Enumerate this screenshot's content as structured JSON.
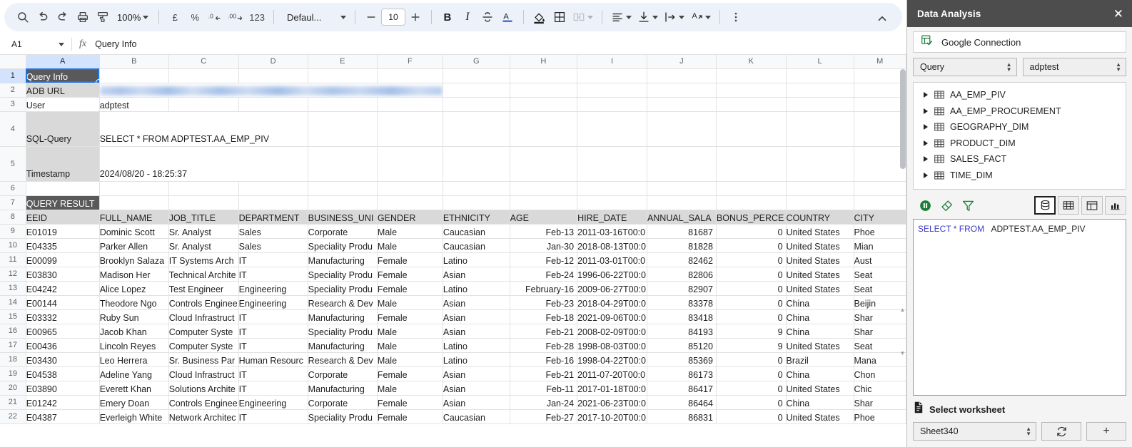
{
  "toolbar": {
    "zoom_level": "100%",
    "font_name": "Defaul...",
    "font_size": "10",
    "currency_symbol": "£",
    "percent_symbol": "%",
    "decimal_decrease": ".0",
    "decimal_increase": ".00",
    "number_format": "123",
    "bold_label": "B",
    "italic_label": "I",
    "text_color_label": "A",
    "items": [
      "search-icon",
      "undo-icon",
      "redo-icon",
      "print-icon",
      "paint-format-icon",
      "zoom-select",
      "currency-format",
      "percent-format",
      "decrease-decimal",
      "increase-decimal",
      "more-formats",
      "font-select",
      "decrease-font-size",
      "font-size-input",
      "increase-font-size",
      "bold",
      "italic",
      "strikethrough",
      "text-color",
      "fill-color",
      "borders",
      "merge-cells",
      "horizontal-align",
      "vertical-align",
      "text-wrap",
      "text-rotation",
      "more-options"
    ]
  },
  "formula_bar": {
    "name_box": "A1",
    "fx_label": "fx",
    "content": "Query Info"
  },
  "grid": {
    "column_letters": [
      "A",
      "B",
      "C",
      "D",
      "E",
      "F",
      "G",
      "H",
      "I",
      "J",
      "K",
      "L",
      "M"
    ],
    "selected_column": "A",
    "selected_row": "1",
    "selected_cell": "A1",
    "info_rows": [
      {
        "row": "1",
        "label": "Query Info",
        "value": "",
        "style": "dark",
        "tall": false
      },
      {
        "row": "2",
        "label": "ADB URL",
        "value": "",
        "style": "blurred-url",
        "tall": false
      },
      {
        "row": "3",
        "label": "User",
        "value": "adptest",
        "style": "plain",
        "tall": false
      },
      {
        "row": "4",
        "label": "SQL-Query",
        "value": "SELECT * FROM ADPTEST.AA_EMP_PIV",
        "style": "grey",
        "tall": true
      },
      {
        "row": "5",
        "label": "Timestamp",
        "value": "2024/08/20 - 18:25:37",
        "style": "grey",
        "tall": true
      },
      {
        "row": "6",
        "label": "",
        "value": "",
        "style": "plain",
        "tall": false
      },
      {
        "row": "7",
        "label": "QUERY RESULT",
        "value": "",
        "style": "dark",
        "tall": false
      }
    ],
    "table_header_row": "8",
    "table_headers": [
      "EEID",
      "FULL_NAME",
      "JOB_TITLE",
      "DEPARTMENT",
      "BUSINESS_UNI",
      "GENDER",
      "ETHNICITY",
      "AGE",
      "HIRE_DATE",
      "ANNUAL_SALA",
      "BONUS_PERCE",
      "COUNTRY",
      "CITY"
    ],
    "table_rows": [
      {
        "row": "9",
        "cells": [
          "E01019",
          "Dominic Scott",
          "Sr. Analyst",
          "Sales",
          "Corporate",
          "Male",
          "Caucasian",
          "Feb-13",
          "2011-03-16T00:0",
          "81687",
          "0",
          "United States",
          "Phoe"
        ]
      },
      {
        "row": "10",
        "cells": [
          "E04335",
          "Parker Allen",
          "Sr. Analyst",
          "Sales",
          "Speciality Produ",
          "Male",
          "Caucasian",
          "Jan-30",
          "2018-08-13T00:0",
          "81828",
          "0",
          "United States",
          "Mian"
        ]
      },
      {
        "row": "11",
        "cells": [
          "E00099",
          "Brooklyn Salaza",
          "IT Systems Arch",
          "IT",
          "Manufacturing",
          "Female",
          "Latino",
          "Feb-12",
          "2011-03-01T00:0",
          "82462",
          "0",
          "United States",
          "Aust"
        ]
      },
      {
        "row": "12",
        "cells": [
          "E03830",
          "Madison Her",
          "Technical Archite",
          "IT",
          "Speciality Produ",
          "Female",
          "Asian",
          "Feb-24",
          "1996-06-22T00:0",
          "82806",
          "0",
          "United States",
          "Seat"
        ]
      },
      {
        "row": "13",
        "cells": [
          "E04242",
          "Alice Lopez",
          "Test Engineer",
          "Engineering",
          "Speciality Produ",
          "Female",
          "Latino",
          "February-16",
          "2009-06-27T00:0",
          "82907",
          "0",
          "United States",
          "Seat"
        ]
      },
      {
        "row": "14",
        "cells": [
          "E00144",
          "Theodore Ngo",
          "Controls Enginee",
          "Engineering",
          "Research & Dev",
          "Male",
          "Asian",
          "Feb-23",
          "2018-04-29T00:0",
          "83378",
          "0",
          "China",
          "Beijin"
        ]
      },
      {
        "row": "15",
        "cells": [
          "E03332",
          "Ruby Sun",
          "Cloud Infrastruct",
          "IT",
          "Manufacturing",
          "Female",
          "Asian",
          "Feb-18",
          "2021-09-06T00:0",
          "83418",
          "0",
          "China",
          "Shar"
        ]
      },
      {
        "row": "16",
        "cells": [
          "E00965",
          "Jacob Khan",
          "Computer Syste",
          "IT",
          "Speciality Produ",
          "Male",
          "Asian",
          "Feb-21",
          "2008-02-09T00:0",
          "84193",
          "9",
          "China",
          "Shar"
        ]
      },
      {
        "row": "17",
        "cells": [
          "E00436",
          "Lincoln Reyes",
          "Computer Syste",
          "IT",
          "Manufacturing",
          "Male",
          "Latino",
          "Feb-28",
          "1998-08-03T00:0",
          "85120",
          "9",
          "United States",
          "Seat"
        ]
      },
      {
        "row": "18",
        "cells": [
          "E03430",
          "Leo Herrera",
          "Sr. Business Par",
          "Human Resourc",
          "Research & Dev",
          "Male",
          "Latino",
          "Feb-16",
          "1998-04-22T00:0",
          "85369",
          "0",
          "Brazil",
          "Mana"
        ]
      },
      {
        "row": "19",
        "cells": [
          "E04538",
          "Adeline Yang",
          "Cloud Infrastruct",
          "IT",
          "Corporate",
          "Female",
          "Asian",
          "Feb-21",
          "2011-07-20T00:0",
          "86173",
          "0",
          "China",
          "Chon"
        ]
      },
      {
        "row": "20",
        "cells": [
          "E03890",
          "Everett Khan",
          "Solutions Archite",
          "IT",
          "Manufacturing",
          "Male",
          "Asian",
          "Feb-11",
          "2017-01-18T00:0",
          "86417",
          "0",
          "United States",
          "Chic"
        ]
      },
      {
        "row": "21",
        "cells": [
          "E01242",
          "Emery Doan",
          "Controls Enginee",
          "Engineering",
          "Corporate",
          "Female",
          "Asian",
          "Jan-24",
          "2021-06-23T00:0",
          "86464",
          "0",
          "China",
          "Shar"
        ]
      },
      {
        "row": "22",
        "cells": [
          "E04387",
          "Everleigh White",
          "Network Architec",
          "IT",
          "Speciality Produ",
          "Female",
          "Caucasian",
          "Feb-27",
          "2017-10-20T00:0",
          "86831",
          "0",
          "United States",
          "Phoe"
        ]
      }
    ]
  },
  "panel": {
    "title": "Data Analysis",
    "close_label": "✕",
    "connection": "Google Connection",
    "source_type": "Query",
    "schema": "adptest",
    "tree": [
      {
        "label": "AA_EMP_PIV"
      },
      {
        "label": "AA_EMP_PROCUREMENT"
      },
      {
        "label": "GEOGRAPHY_DIM"
      },
      {
        "label": "PRODUCT_DIM"
      },
      {
        "label": "SALES_FACT"
      },
      {
        "label": "TIME_DIM"
      }
    ],
    "actions": [
      "run-query-icon",
      "clear-icon",
      "filter-icon"
    ],
    "views": [
      "data-view",
      "table-view",
      "pivot-view",
      "chart-view"
    ],
    "active_view": "data-view",
    "sql_keyword_1": "SELECT * FROM",
    "sql_identifier": "ADPTEST.AA_EMP_PIV",
    "worksheet_section_label": "Select worksheet",
    "worksheet_value": "Sheet340",
    "refresh_label": "↻",
    "add_label": "+",
    "accent_green": "#1a7f37",
    "accent_blue": "#1a73e8",
    "header_bg": "#4d4d4d"
  }
}
